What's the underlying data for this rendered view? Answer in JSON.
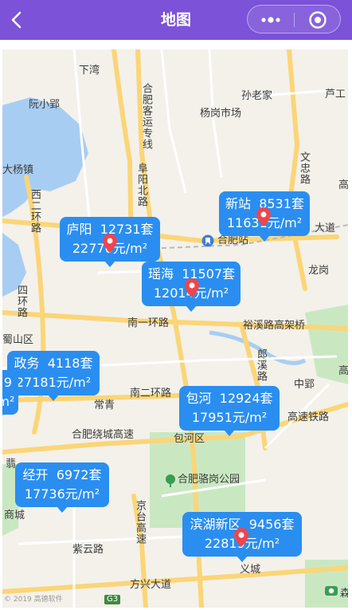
{
  "header": {
    "title": "地图",
    "bg_color": "#7b52d8"
  },
  "map": {
    "place_labels": [
      {
        "name": "label-xiawan",
        "text": "下湾"
      },
      {
        "name": "label-sunlaojia",
        "text": "孙老家"
      },
      {
        "name": "label-luting",
        "text": "芦工"
      },
      {
        "name": "label-ruanxiaoying",
        "text": "阮小郢"
      },
      {
        "name": "label-yanggangshichang",
        "text": "杨岗市场"
      },
      {
        "name": "label-dayangzhen",
        "text": "大杨镇"
      },
      {
        "name": "label-hefeizhan",
        "text": "合肥站"
      },
      {
        "name": "label-longgang",
        "text": "龙岗"
      },
      {
        "name": "label-nanyihuanlu",
        "text": "南一环路"
      },
      {
        "name": "label-shushanqu",
        "text": "蜀山区"
      },
      {
        "name": "label-yuxilugaojiaqiao",
        "text": "裕溪路高架桥"
      },
      {
        "name": "label-changqing",
        "text": "常青"
      },
      {
        "name": "label-nanerhuanlu",
        "text": "南二环路"
      },
      {
        "name": "label-zhongying",
        "text": "中郢"
      },
      {
        "name": "label-hefeiraochenggaosu",
        "text": "合肥绕城高速"
      },
      {
        "name": "label-baohequ",
        "text": "包河区"
      },
      {
        "name": "label-gaosutielu",
        "text": "高速铁路"
      },
      {
        "name": "label-hefeiluogangpark",
        "text": "合肥骆岗公园"
      },
      {
        "name": "label-shangcheng",
        "text": "商城"
      },
      {
        "name": "label-ziyunlu",
        "text": "紫云路"
      },
      {
        "name": "label-fangxingdadao",
        "text": "方兴大道"
      },
      {
        "name": "label-yicheng",
        "text": "义城"
      },
      {
        "name": "label-dadao",
        "text": "大道"
      },
      {
        "name": "label-gao1",
        "text": "高"
      },
      {
        "name": "label-gao2",
        "text": "高"
      },
      {
        "name": "label-g3",
        "text": "G3"
      },
      {
        "name": "label-senlin",
        "text": "森"
      }
    ],
    "vertical_labels": [
      {
        "name": "label-hefeikeyunzhuanxian",
        "text": "合肥客运专线"
      },
      {
        "name": "label-fuyangbeilu",
        "text": "阜阳北路"
      },
      {
        "name": "label-wenzhong",
        "text": "文忠路"
      },
      {
        "name": "label-xierhuanlu",
        "text": "西二环路"
      },
      {
        "name": "label-sihuanlu",
        "text": "四环路"
      },
      {
        "name": "label-langxilu",
        "text": "郎溪路"
      },
      {
        "name": "label-jingtaigaosu",
        "text": "京台高速"
      },
      {
        "name": "label-fan",
        "text": "翡"
      }
    ]
  },
  "clusters": [
    {
      "name": "cluster-luyang",
      "district": "庐阳",
      "count": "12731套",
      "price": "22770元/m²"
    },
    {
      "name": "cluster-xinzhan",
      "district": "新站",
      "count": "8531套",
      "price": "11631元/m²"
    },
    {
      "name": "cluster-yaohai",
      "district": "瑶海",
      "count": "11507套",
      "price": "12014元/m²"
    },
    {
      "name": "cluster-zhengwu",
      "district": "政务",
      "count": "4118套",
      "price": "27181元/m²"
    },
    {
      "name": "cluster-zhengwu-edge",
      "district": "9",
      "count": "",
      "price": "元/m²"
    },
    {
      "name": "cluster-baohe",
      "district": "包河",
      "count": "12924套",
      "price": "17951元/m²"
    },
    {
      "name": "cluster-jingkai",
      "district": "经开",
      "count": "6972套",
      "price": "17736元/m²"
    },
    {
      "name": "cluster-binhuxinqu",
      "district": "滨湖新区",
      "count": "9456套",
      "price": "22819元/m²"
    }
  ],
  "watermark": "© 2019 高德软件",
  "colors": {
    "bubble": "#2a8ef0",
    "pin": "#f0454a",
    "water": "#a8cdf2",
    "green": "#c9e8c2",
    "road_major": "#fbd577",
    "road_minor": "#ffffff"
  }
}
